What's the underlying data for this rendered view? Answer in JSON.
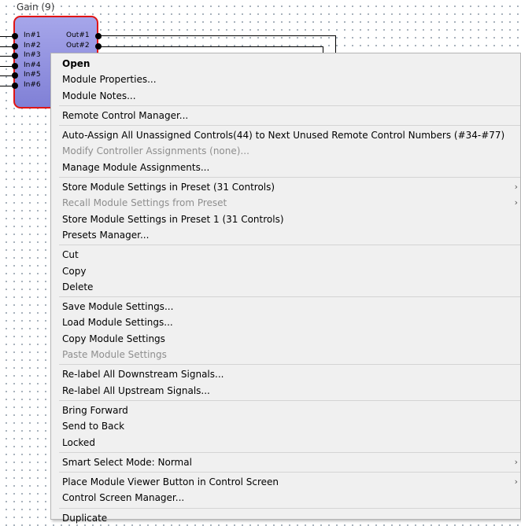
{
  "module": {
    "title": "Gain (9)",
    "inputs": [
      "In#1",
      "In#2",
      "In#3",
      "In#4",
      "In#5",
      "In#6"
    ],
    "outputs": [
      "Out#1",
      "Out#2"
    ],
    "border_color": "#e01515",
    "fill_color": "#8f8fde"
  },
  "context_menu": {
    "groups": [
      {
        "items": [
          {
            "id": "open",
            "label": "Open",
            "bold": true
          },
          {
            "id": "module-properties",
            "label": "Module Properties..."
          },
          {
            "id": "module-notes",
            "label": "Module Notes..."
          }
        ]
      },
      {
        "items": [
          {
            "id": "remote-control-manager",
            "label": "Remote Control Manager..."
          }
        ]
      },
      {
        "items": [
          {
            "id": "auto-assign",
            "label": "Auto-Assign All Unassigned Controls(44) to Next Unused Remote Control Numbers (#34-#77)"
          },
          {
            "id": "modify-controller-assignments",
            "label": "Modify Controller Assignments (none)...",
            "disabled": true
          },
          {
            "id": "manage-module-assignments",
            "label": "Manage Module Assignments..."
          }
        ]
      },
      {
        "items": [
          {
            "id": "store-module-settings-in-preset",
            "label": "Store Module Settings in Preset (31 Controls)",
            "submenu": true
          },
          {
            "id": "recall-module-settings",
            "label": "Recall Module Settings from Preset",
            "submenu": true,
            "disabled": true
          },
          {
            "id": "store-module-settings-preset-1",
            "label": "Store Module Settings in Preset 1 (31 Controls)"
          },
          {
            "id": "presets-manager",
            "label": "Presets Manager..."
          }
        ]
      },
      {
        "items": [
          {
            "id": "cut",
            "label": "Cut"
          },
          {
            "id": "copy",
            "label": "Copy"
          },
          {
            "id": "delete",
            "label": "Delete"
          }
        ]
      },
      {
        "items": [
          {
            "id": "save-module-settings",
            "label": "Save Module Settings..."
          },
          {
            "id": "load-module-settings",
            "label": "Load Module Settings..."
          },
          {
            "id": "copy-module-settings",
            "label": "Copy Module Settings"
          },
          {
            "id": "paste-module-settings",
            "label": "Paste Module Settings",
            "disabled": true
          }
        ]
      },
      {
        "items": [
          {
            "id": "relabel-downstream",
            "label": "Re-label All Downstream Signals..."
          },
          {
            "id": "relabel-upstream",
            "label": "Re-label All Upstream Signals..."
          }
        ]
      },
      {
        "items": [
          {
            "id": "bring-forward",
            "label": "Bring Forward"
          },
          {
            "id": "send-to-back",
            "label": "Send to Back"
          },
          {
            "id": "locked",
            "label": "Locked"
          }
        ]
      },
      {
        "items": [
          {
            "id": "smart-select-mode",
            "label": "Smart Select Mode: Normal",
            "submenu": true
          }
        ]
      },
      {
        "items": [
          {
            "id": "place-module-viewer-button",
            "label": "Place Module Viewer Button in Control Screen",
            "submenu": true
          },
          {
            "id": "control-screen-manager",
            "label": "Control Screen Manager..."
          }
        ]
      },
      {
        "items": [
          {
            "id": "duplicate",
            "label": "Duplicate"
          }
        ]
      }
    ],
    "submenu_icon": "chevron-right-icon"
  }
}
